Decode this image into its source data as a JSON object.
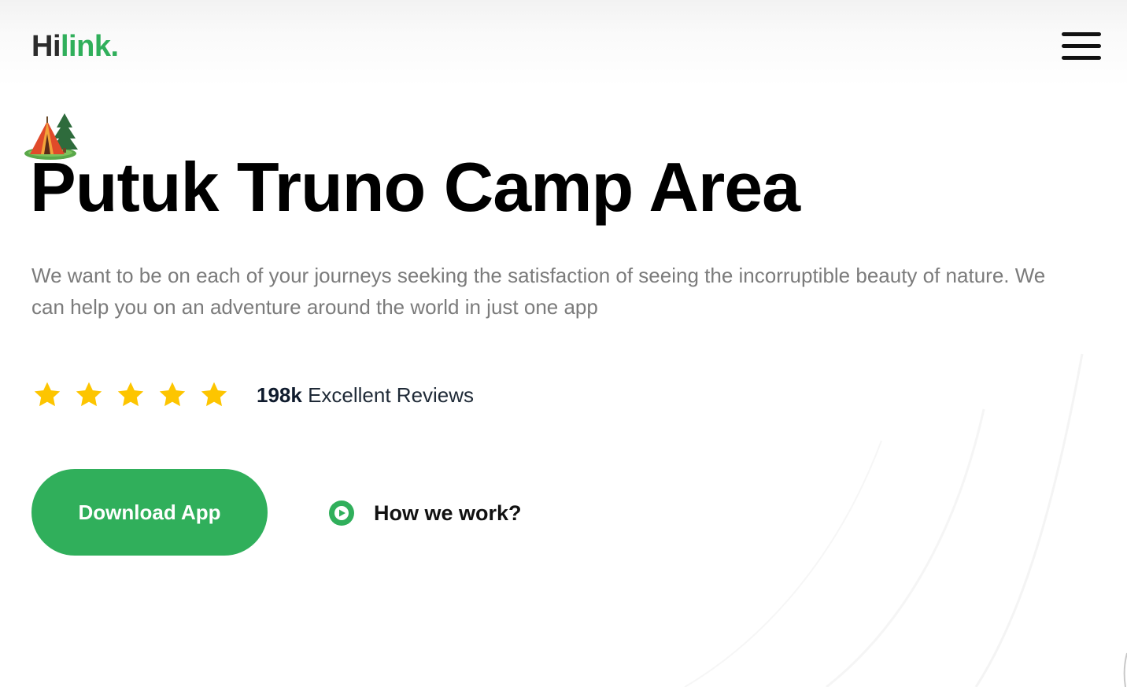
{
  "header": {
    "logo_main": "Hi",
    "logo_accent": "link."
  },
  "hero": {
    "icon": "camp-tent-icon",
    "title": "Putuk Truno Camp Area",
    "description": "We want to be on each of your journeys seeking the satisfaction of seeing the incorruptible beauty of nature. We can help you on an adventure around the world in just one app",
    "rating": {
      "stars": 5,
      "max_stars": 5,
      "count": "198k",
      "label": " Excellent Reviews"
    },
    "primary_button": "Download App",
    "secondary_link": "How we work?"
  },
  "colors": {
    "accent": "#30af5b",
    "star": "#fdc500",
    "title": "#000000",
    "description": "#7b7b7b"
  },
  "icons": {
    "menu": "hamburger-menu-icon",
    "star": "star-icon",
    "play": "play-circle-icon"
  }
}
